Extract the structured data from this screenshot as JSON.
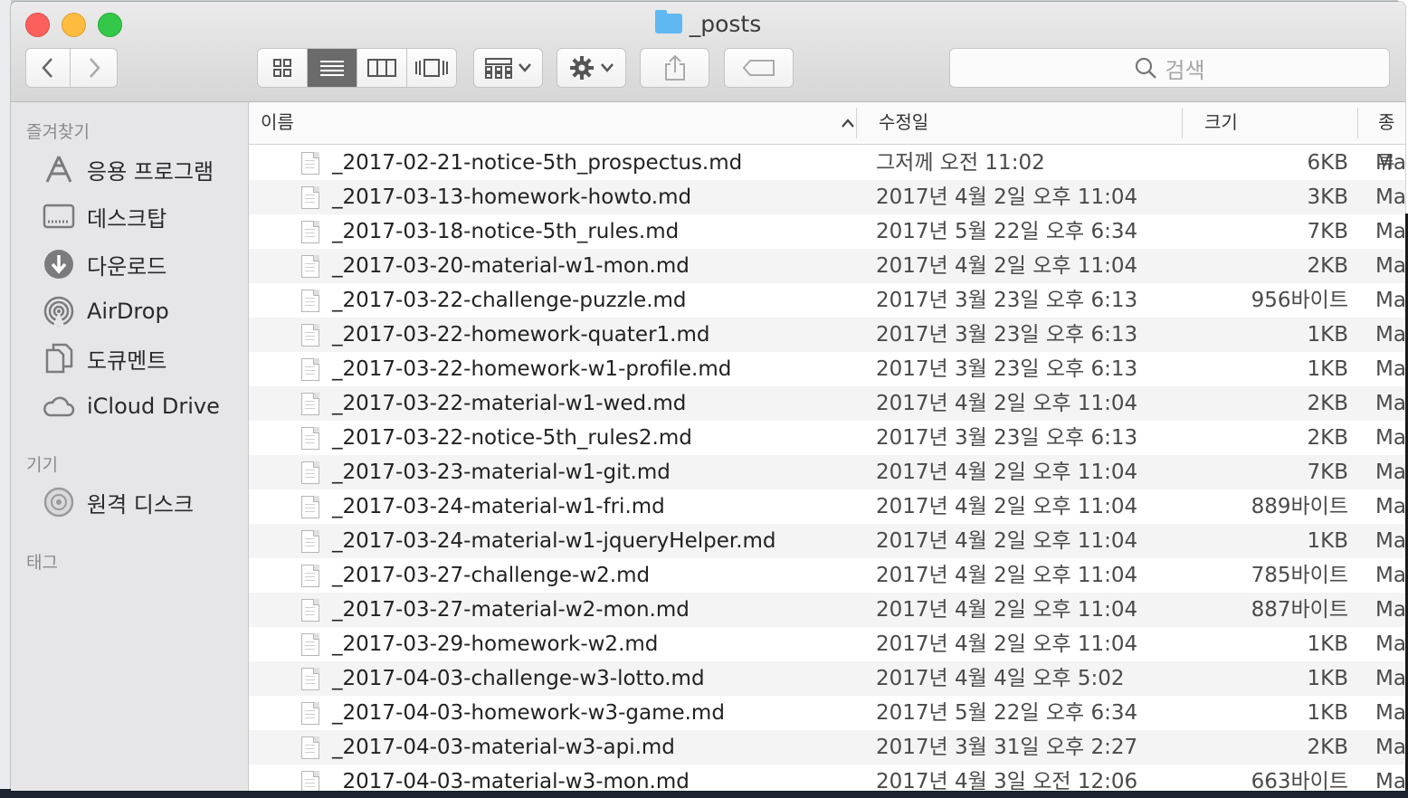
{
  "window": {
    "title": "_posts"
  },
  "toolbar": {
    "view_icon_names": [
      "icon-view-icon",
      "list-view-icon",
      "column-view-icon",
      "cover-flow-icon"
    ],
    "search_placeholder": "검색"
  },
  "sidebar": {
    "favorites_header": "즐겨찾기",
    "favorites": [
      {
        "label": "응용 프로그램",
        "icon": "applications-icon"
      },
      {
        "label": "데스크탑",
        "icon": "desktop-icon"
      },
      {
        "label": "다운로드",
        "icon": "downloads-icon"
      },
      {
        "label": "AirDrop",
        "icon": "airdrop-icon"
      },
      {
        "label": "도큐멘트",
        "icon": "documents-icon"
      },
      {
        "label": "iCloud Drive",
        "icon": "icloud-icon"
      }
    ],
    "devices_header": "기기",
    "devices": [
      {
        "label": "원격 디스크",
        "icon": "remote-disc-icon"
      }
    ],
    "tags_header": "태그"
  },
  "columns": {
    "name": "이름",
    "modified": "수정일",
    "size": "크기",
    "kind": "종류"
  },
  "files": [
    {
      "name": "_2017-02-21-notice-5th_prospectus.md",
      "modified": "그저께 오전 11:02",
      "size": "6KB",
      "kind": "Ma"
    },
    {
      "name": "_2017-03-13-homework-howto.md",
      "modified": "2017년 4월 2일 오후 11:04",
      "size": "3KB",
      "kind": "Ma"
    },
    {
      "name": "_2017-03-18-notice-5th_rules.md",
      "modified": "2017년 5월 22일 오후 6:34",
      "size": "7KB",
      "kind": "Ma"
    },
    {
      "name": "_2017-03-20-material-w1-mon.md",
      "modified": "2017년 4월 2일 오후 11:04",
      "size": "2KB",
      "kind": "Ma"
    },
    {
      "name": "_2017-03-22-challenge-puzzle.md",
      "modified": "2017년 3월 23일 오후 6:13",
      "size": "956바이트",
      "kind": "Ma"
    },
    {
      "name": "_2017-03-22-homework-quater1.md",
      "modified": "2017년 3월 23일 오후 6:13",
      "size": "1KB",
      "kind": "Ma"
    },
    {
      "name": "_2017-03-22-homework-w1-profile.md",
      "modified": "2017년 3월 23일 오후 6:13",
      "size": "1KB",
      "kind": "Ma"
    },
    {
      "name": "_2017-03-22-material-w1-wed.md",
      "modified": "2017년 4월 2일 오후 11:04",
      "size": "2KB",
      "kind": "Ma"
    },
    {
      "name": "_2017-03-22-notice-5th_rules2.md",
      "modified": "2017년 3월 23일 오후 6:13",
      "size": "2KB",
      "kind": "Ma"
    },
    {
      "name": "_2017-03-23-material-w1-git.md",
      "modified": "2017년 4월 2일 오후 11:04",
      "size": "7KB",
      "kind": "Ma"
    },
    {
      "name": "_2017-03-24-material-w1-fri.md",
      "modified": "2017년 4월 2일 오후 11:04",
      "size": "889바이트",
      "kind": "Ma"
    },
    {
      "name": "_2017-03-24-material-w1-jqueryHelper.md",
      "modified": "2017년 4월 2일 오후 11:04",
      "size": "1KB",
      "kind": "Ma"
    },
    {
      "name": "_2017-03-27-challenge-w2.md",
      "modified": "2017년 4월 2일 오후 11:04",
      "size": "785바이트",
      "kind": "Ma"
    },
    {
      "name": "_2017-03-27-material-w2-mon.md",
      "modified": "2017년 4월 2일 오후 11:04",
      "size": "887바이트",
      "kind": "Ma"
    },
    {
      "name": "_2017-03-29-homework-w2.md",
      "modified": "2017년 4월 2일 오후 11:04",
      "size": "1KB",
      "kind": "Ma"
    },
    {
      "name": "_2017-04-03-challenge-w3-lotto.md",
      "modified": "2017년 4월 4일 오후 5:02",
      "size": "1KB",
      "kind": "Ma"
    },
    {
      "name": "_2017-04-03-homework-w3-game.md",
      "modified": "2017년 5월 22일 오후 6:34",
      "size": "1KB",
      "kind": "Ma"
    },
    {
      "name": "_2017-04-03-material-w3-api.md",
      "modified": "2017년 3월 31일 오후 2:27",
      "size": "2KB",
      "kind": "Ma"
    },
    {
      "name": "_2017-04-03-material-w3-mon.md",
      "modified": "2017년 4월 3일 오전 12:06",
      "size": "663바이트",
      "kind": "Ma"
    }
  ]
}
